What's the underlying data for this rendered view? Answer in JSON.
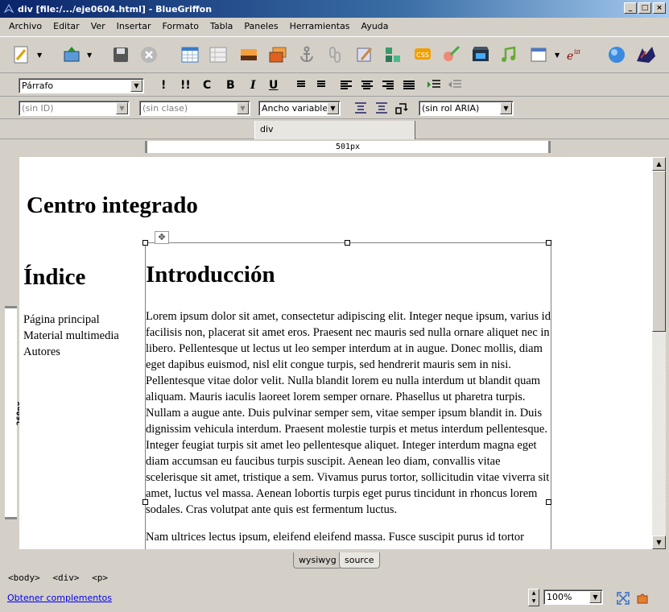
{
  "window": {
    "title": "div [file:/.../eje0604.html] - BlueGriffon"
  },
  "menu": [
    "Archivo",
    "Editar",
    "Ver",
    "Insertar",
    "Formato",
    "Tabla",
    "Paneles",
    "Herramientas",
    "Ayuda"
  ],
  "format_bar": {
    "paragraph_style": "Párrafo",
    "b": "!",
    "bb": "!!",
    "c": "C",
    "bold": "B",
    "italic": "I",
    "underline": "U"
  },
  "attr_bar": {
    "id": "(sin ID)",
    "class": "(sin clase)",
    "width_mode": "Ancho variable",
    "aria_role": "(sin rol ARIA)"
  },
  "tab": {
    "label": "div"
  },
  "ruler": {
    "horizontal": "501px",
    "vertical": "260px"
  },
  "document": {
    "site_title": "Centro integrado",
    "nav_heading": "Índice",
    "nav_links": [
      "Página principal",
      "Material multimedia",
      "Autores"
    ],
    "section_heading": "Introducción",
    "paragraph1": "Lorem ipsum dolor sit amet, consectetur adipiscing elit. Integer neque ipsum, varius id facilisis non, placerat sit amet eros. Praesent nec mauris sed nulla ornare aliquet nec in libero. Pellentesque ut lectus ut leo semper interdum at in augue. Donec mollis, diam eget dapibus euismod, nisl elit congue turpis, sed hendrerit mauris sem in nisi. Pellentesque vitae dolor velit. Nulla blandit lorem eu nulla interdum ut blandit quam aliquam. Mauris iaculis laoreet lorem semper ornare. Phasellus ut pharetra turpis. Nullam a augue ante. Duis pulvinar semper sem, vitae semper ipsum blandit in. Duis dignissim vehicula interdum. Praesent molestie turpis et metus interdum pellentesque. Integer feugiat turpis sit amet leo pellentesque aliquet. Integer interdum magna eget diam accumsan eu faucibus turpis suscipit. Aenean leo diam, convallis vitae scelerisque sit amet, tristique a sem. Vivamus purus tortor, sollicitudin vitae viverra sit amet, luctus vel massa. Aenean lobortis turpis eget purus tincidunt in rhoncus lorem sodales. Cras volutpat ante quis est fermentum luctus.",
    "paragraph2": "Nam ultrices lectus ipsum, eleifend eleifend massa. Fusce suscipit purus id tortor"
  },
  "mode_tabs": {
    "wysiwyg": "wysiwyg",
    "source": "source"
  },
  "status": {
    "breadcrumb": [
      "<body>",
      "<div>",
      "<p>"
    ],
    "addons_link": "Obtener complementos",
    "zoom": "100%"
  }
}
